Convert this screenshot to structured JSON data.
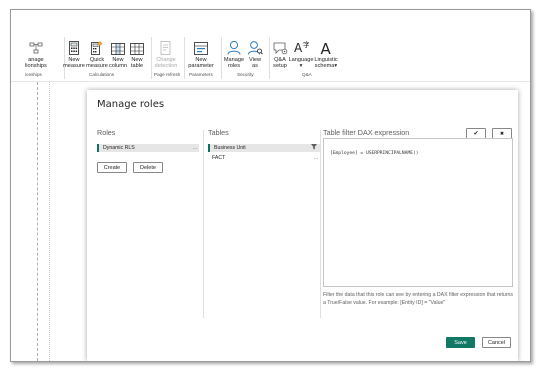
{
  "ribbon": {
    "relationships": {
      "label_line1": "anage",
      "label_line2": "lionships"
    },
    "relationships_group": "ionships",
    "new_measure": {
      "line1": "New",
      "line2": "measure"
    },
    "quick_measure": {
      "line1": "Quick",
      "line2": "measure"
    },
    "new_column": {
      "line1": "New",
      "line2": "column"
    },
    "new_table": {
      "line1": "New",
      "line2": "table"
    },
    "calculations_group": "Calculations",
    "change_detection": {
      "line1": "Change",
      "line2": "detection"
    },
    "page_refresh_group": "Page refresh",
    "new_parameter": {
      "line1": "New",
      "line2": "parameter"
    },
    "parameters_group": "Parameters",
    "manage_roles": {
      "line1": "Manage",
      "line2": "roles"
    },
    "view_as": {
      "line1": "View",
      "line2": "as"
    },
    "security_group": "Security",
    "qa_setup": {
      "line1": "Q&A",
      "line2": "setup"
    },
    "language": {
      "line1": "Language",
      "line2": ""
    },
    "linguistic_schema": {
      "line1": "Linguistic",
      "line2": "schema"
    },
    "qa_group": "Q&A"
  },
  "dialog": {
    "title": "Manage roles",
    "roles_header": "Roles",
    "roles": [
      {
        "name": "Dynamic RLS",
        "more": "..."
      }
    ],
    "create_label": "Create",
    "delete_label": "Delete",
    "tables_header": "Tables",
    "tables": [
      {
        "name": "Business Unit",
        "more": "..."
      },
      {
        "name": "FACT",
        "more": "..."
      }
    ],
    "dax_header": "Table filter DAX expression",
    "accept_label": "✔",
    "cancel_expr_label": "✖",
    "dax_expression": "[Employee] = USERPRINCIPALNAME()",
    "help_text": "Filter the data that this role can see by entering a DAX filter expression that returns a True/False value. For example: [Entity ID] = \"Value\"",
    "save_label": "Save",
    "cancel_label": "Cancel"
  },
  "colors": {
    "accent": "#117865",
    "selection_border": "#0f6f62"
  }
}
